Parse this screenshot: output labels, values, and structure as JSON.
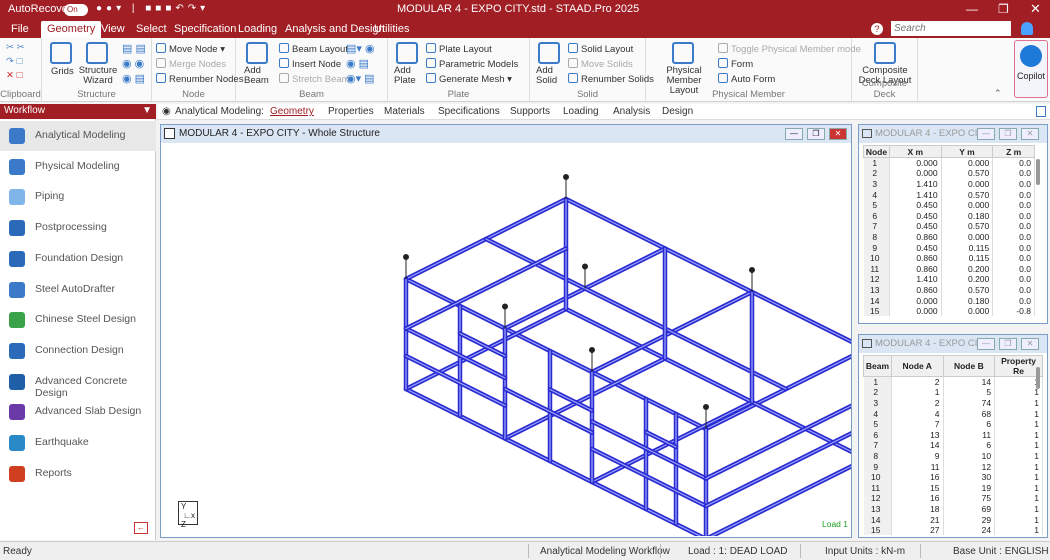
{
  "titlebar": {
    "autorecovery_label": "AutoRecovery",
    "toggle_state": "On",
    "title": "MODULAR 4 - EXPO CITY.std - STAAD.Pro 2025"
  },
  "menubar": {
    "tabs": [
      "File",
      "Geometry",
      "View",
      "Select",
      "Specification",
      "Loading",
      "Analysis and Design",
      "Utilities"
    ],
    "active": "Geometry",
    "search_placeholder": "Search"
  },
  "ribbon": {
    "clipboard_label": "Clipboard",
    "structure": {
      "grids": "Grids",
      "wizard": "Structure Wizard",
      "label": "Structure"
    },
    "node": {
      "move": "Move Node",
      "merge": "Merge Nodes",
      "renumber": "Renumber Nodes",
      "label": "Node"
    },
    "beam": {
      "add": "Add Beam",
      "layout": "Beam Layout",
      "insert": "Insert Node",
      "stretch": "Stretch Beam",
      "label": "Beam"
    },
    "plate": {
      "add": "Add Plate",
      "layout": "Plate Layout",
      "parametric": "Parametric Models",
      "mesh": "Generate Mesh",
      "label": "Plate"
    },
    "solid": {
      "add": "Add Solid",
      "layout": "Solid Layout",
      "move": "Move Solids",
      "renumber": "Renumber Solids",
      "label": "Solid"
    },
    "physical": {
      "layout": "Physical Member Layout",
      "toggle": "Toggle Physical Member mode",
      "form": "Form",
      "autoform": "Auto Form",
      "label": "Physical Member"
    },
    "composite": {
      "layout": "Composite Deck Layout",
      "label": "Composite Deck"
    },
    "copilot": "Copilot"
  },
  "subbar": {
    "prefix": "Analytical Modeling:",
    "items": [
      "Geometry",
      "Properties",
      "Materials",
      "Specifications",
      "Supports",
      "Loading",
      "Analysis",
      "Design"
    ],
    "active": "Geometry"
  },
  "workflow": {
    "title": "Workflow",
    "items": [
      {
        "label": "Analytical Modeling",
        "icon": "analytical-icon",
        "color": "#3a7ac8"
      },
      {
        "label": "Physical Modeling",
        "icon": "physical-icon",
        "color": "#3a7ac8"
      },
      {
        "label": "Piping",
        "icon": "piping-icon",
        "color": "#7fb5e8"
      },
      {
        "label": "Postprocessing",
        "icon": "postprocessing-icon",
        "color": "#2a6ab8"
      },
      {
        "label": "Foundation Design",
        "icon": "foundation-icon",
        "color": "#2a6ab8"
      },
      {
        "label": "Steel AutoDrafter",
        "icon": "drafter-icon",
        "color": "#3a7ac8"
      },
      {
        "label": "Chinese Steel Design",
        "icon": "chinese-steel-icon",
        "color": "#3aa34a"
      },
      {
        "label": "Connection Design",
        "icon": "connection-icon",
        "color": "#2a6ab8"
      },
      {
        "label": "Advanced Concrete Design",
        "icon": "concrete-icon",
        "color": "#1e5fa8"
      },
      {
        "label": "Advanced Slab Design",
        "icon": "slab-icon",
        "color": "#6a3aa8"
      },
      {
        "label": "Earthquake",
        "icon": "earthquake-icon",
        "color": "#2a8ac8"
      },
      {
        "label": "Reports",
        "icon": "reports-icon",
        "color": "#d04020"
      }
    ]
  },
  "viewport": {
    "title": "MODULAR 4 - EXPO CITY - Whole Structure",
    "load_label": "Load 1"
  },
  "node_table": {
    "title": "MODULAR 4 - EXPO CITY...",
    "headers": [
      "Node",
      "X m",
      "Y m",
      "Z m"
    ],
    "rows": [
      [
        "1",
        "0.000",
        "0.000",
        "0.0"
      ],
      [
        "2",
        "0.000",
        "0.570",
        "0.0"
      ],
      [
        "3",
        "1.410",
        "0.000",
        "0.0"
      ],
      [
        "4",
        "1.410",
        "0.570",
        "0.0"
      ],
      [
        "5",
        "0.450",
        "0.000",
        "0.0"
      ],
      [
        "6",
        "0.450",
        "0.180",
        "0.0"
      ],
      [
        "7",
        "0.450",
        "0.570",
        "0.0"
      ],
      [
        "8",
        "0.860",
        "0.000",
        "0.0"
      ],
      [
        "9",
        "0.450",
        "0.115",
        "0.0"
      ],
      [
        "10",
        "0.860",
        "0.115",
        "0.0"
      ],
      [
        "11",
        "0.860",
        "0.200",
        "0.0"
      ],
      [
        "12",
        "1.410",
        "0.200",
        "0.0"
      ],
      [
        "13",
        "0.860",
        "0.570",
        "0.0"
      ],
      [
        "14",
        "0.000",
        "0.180",
        "0.0"
      ],
      [
        "15",
        "0.000",
        "0.000",
        "-0.8"
      ]
    ]
  },
  "beam_table": {
    "title": "MODULAR 4 - EXPO CITY...",
    "headers": [
      "Beam",
      "Node A",
      "Node B",
      "Property Re"
    ],
    "rows": [
      [
        "1",
        "2",
        "14",
        "1"
      ],
      [
        "2",
        "1",
        "5",
        "1"
      ],
      [
        "3",
        "2",
        "74",
        "1"
      ],
      [
        "4",
        "4",
        "68",
        "1"
      ],
      [
        "5",
        "7",
        "6",
        "1"
      ],
      [
        "6",
        "13",
        "11",
        "1"
      ],
      [
        "7",
        "14",
        "6",
        "1"
      ],
      [
        "8",
        "9",
        "10",
        "1"
      ],
      [
        "9",
        "11",
        "12",
        "1"
      ],
      [
        "10",
        "16",
        "30",
        "1"
      ],
      [
        "11",
        "15",
        "19",
        "1"
      ],
      [
        "12",
        "16",
        "75",
        "1"
      ],
      [
        "13",
        "18",
        "69",
        "1"
      ],
      [
        "14",
        "21",
        "29",
        "1"
      ],
      [
        "15",
        "27",
        "24",
        "1"
      ]
    ]
  },
  "statusbar": {
    "ready": "Ready",
    "workflow": "Analytical Modeling Workflow",
    "load": "Load : 1: DEAD LOAD",
    "units": "Input Units : kN-m",
    "base": "Base Unit : ENGLISH"
  },
  "colors": {
    "brand": "#a01e24",
    "structure": "#2a2ad0"
  }
}
